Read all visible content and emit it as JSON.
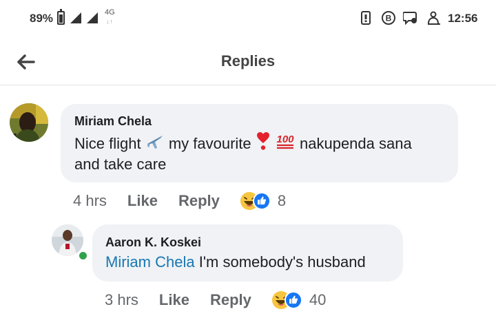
{
  "status_bar": {
    "battery": "89%",
    "network": "4G",
    "network_arrows": "↓↑",
    "time": "12:56",
    "icons": [
      "battery-icon",
      "signal-icon",
      "vibrate-icon",
      "b-notification-icon",
      "chat-bubble-icon",
      "person-icon"
    ]
  },
  "header": {
    "title": "Replies",
    "back_icon": "arrow-left-icon"
  },
  "comments": [
    {
      "author": "Miriam Chela",
      "text_parts": [
        "Nice flight ",
        " my favourite ",
        " ",
        " nakupenda sana",
        "and take care"
      ],
      "emojis": [
        "airplane",
        "heart-exclamation",
        "hundred-points"
      ],
      "time": "4 hrs",
      "like_label": "Like",
      "reply_label": "Reply",
      "reaction_count": "8",
      "reactions": [
        "haha",
        "like"
      ]
    },
    {
      "author": "Aaron K. Koskei",
      "mention": "Miriam Chela",
      "text": " I'm somebody's husband",
      "time": "3 hrs",
      "like_label": "Like",
      "reply_label": "Reply",
      "reaction_count": "40",
      "reactions": [
        "haha",
        "like"
      ],
      "online": true
    }
  ],
  "colors": {
    "mention": "#1877b2",
    "bubble": "#f0f2f5",
    "meta_text": "#65676b",
    "like_blue": "#1877f2",
    "haha_yellow": "#f7c640",
    "online_green": "#31a24c"
  }
}
